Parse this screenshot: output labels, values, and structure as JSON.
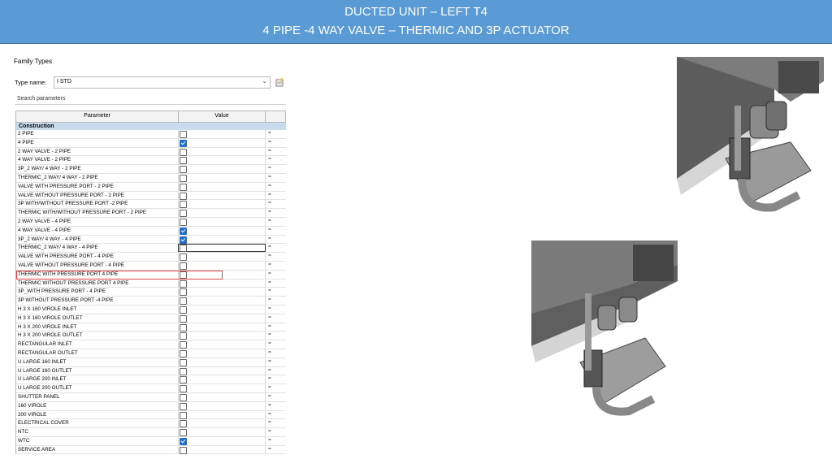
{
  "banner": {
    "line1": "DUCTED UNIT – LEFT T4",
    "line2": "4 PIPE -4 WAY VALVE  – THERMIC AND 3P ACTUATOR"
  },
  "family_types": {
    "title": "Family Types",
    "type_name_label": "Type name:",
    "type_name_value": "I STD",
    "search_placeholder": "Search parameters",
    "col_parameter": "Parameter",
    "col_value": "Value",
    "section": "Construction",
    "rows": [
      {
        "name": "2 PIPE",
        "checked": false
      },
      {
        "name": "4 PIPE",
        "checked": true
      },
      {
        "name": "2 WAY  VALVE - 2 PIPE",
        "checked": false
      },
      {
        "name": "4 WAY VALVE - 2 PIPE",
        "checked": false
      },
      {
        "name": "3P_2 WAY/ 4 WAY - 2 PIPE",
        "checked": false
      },
      {
        "name": "THERMIC_2 WAY/ 4 WAY - 2 PIPE",
        "checked": false
      },
      {
        "name": "VALVE WITH PRESSURE PORT - 2 PIPE",
        "checked": false
      },
      {
        "name": "VALVE WITHOUT PRESSURE PORT - 2  PIPE",
        "checked": false
      },
      {
        "name": "3P WITH/WITHOUT PRESSURE PORT -2 PIPE",
        "checked": false
      },
      {
        "name": "THERMIC WITH/WITHOUT PRESSURE PORT - 2 PIPE",
        "checked": false
      },
      {
        "name": "2 WAY VALVE - 4 PIPE",
        "checked": false
      },
      {
        "name": "4 WAY VALVE - 4 PIPE",
        "checked": true
      },
      {
        "name": "3P_2 WAY/ 4 WAY - 4 PIPE",
        "checked": true
      },
      {
        "name": "THERMIC_2 WAY/ 4 WAY - 4 PIPE",
        "checked": false
      },
      {
        "name": "VALVE WITH PRESSURE PORT - 4 PIPE",
        "checked": false
      },
      {
        "name": "VALVE WITHOUT PRESSURE PORT - 4 PIPE",
        "checked": false
      },
      {
        "name": "THERMIC WITH PRESSURE PORT 4 PIPE",
        "checked": false
      },
      {
        "name": "THERMIC WITHOUT PRESSURE PORT  4 PIPE",
        "checked": false
      },
      {
        "name": "3P_WITH PRESSURE PORT - 4 PIPE",
        "checked": false
      },
      {
        "name": "3P WITHOUT PRESSURE PORT -4  PIPE",
        "checked": false
      },
      {
        "name": "H  3 X 160 VIROLE INLET",
        "checked": false
      },
      {
        "name": "H  3 X 160 VIROLE OUTLET",
        "checked": false
      },
      {
        "name": "H  3 X 200 VIROLE INLET",
        "checked": false
      },
      {
        "name": "H  3 X 200 VIROLE OUTLET",
        "checked": false
      },
      {
        "name": "RECTANGULAR INLET",
        "checked": false
      },
      {
        "name": "RECTANGULAR OUTLET",
        "checked": false
      },
      {
        "name": "U LARGE 160 INLET",
        "checked": false
      },
      {
        "name": "U LARGE 160 OUTLET",
        "checked": false
      },
      {
        "name": "U LARGE 200 INLET",
        "checked": false
      },
      {
        "name": "U LARGE 200 OUTLET",
        "checked": false
      },
      {
        "name": "SHUTTER PANEL",
        "checked": false
      },
      {
        "name": "160 VIROLE",
        "checked": false
      },
      {
        "name": "200 VIROLE",
        "checked": false
      },
      {
        "name": "ELECTRICAL COVER",
        "checked": false
      },
      {
        "name": "NTC",
        "checked": false
      },
      {
        "name": "WTC",
        "checked": true
      },
      {
        "name": "SERVICE AREA",
        "checked": false
      }
    ],
    "formula_symbol": "=",
    "active_row_index": 13,
    "highlight_row_index": 11
  },
  "colors": {
    "banner": "#5b9bd5",
    "checked": "#1e6fd0",
    "highlight": "#e04040",
    "section": "#c9dcee"
  },
  "images": {
    "top": "ducted-unit-3d-view-thermic",
    "bottom": "ducted-unit-3d-view-3p-actuator"
  }
}
